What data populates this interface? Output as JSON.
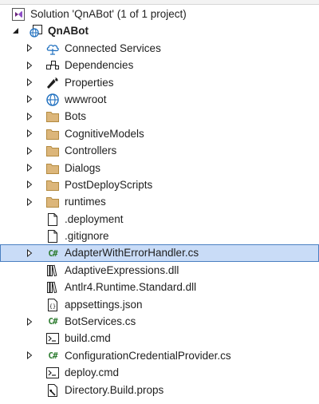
{
  "solution": {
    "label": "Solution 'QnABot' (1 of 1 project)"
  },
  "project": {
    "label": "QnABot"
  },
  "items": [
    {
      "label": "Connected Services",
      "icon": "connected-services-icon"
    },
    {
      "label": "Dependencies",
      "icon": "dependencies-icon"
    },
    {
      "label": "Properties",
      "icon": "properties-wrench-icon"
    },
    {
      "label": "wwwroot",
      "icon": "globe-icon"
    },
    {
      "label": "Bots",
      "icon": "folder-icon"
    },
    {
      "label": "CognitiveModels",
      "icon": "folder-icon"
    },
    {
      "label": "Controllers",
      "icon": "folder-icon"
    },
    {
      "label": "Dialogs",
      "icon": "folder-icon"
    },
    {
      "label": "PostDeployScripts",
      "icon": "folder-icon"
    },
    {
      "label": "runtimes",
      "icon": "folder-icon"
    },
    {
      "label": ".deployment",
      "icon": "file-icon"
    },
    {
      "label": ".gitignore",
      "icon": "file-icon"
    },
    {
      "label": "AdapterWithErrorHandler.cs",
      "icon": "csharp-file-icon",
      "selected": true
    },
    {
      "label": "AdaptiveExpressions.dll",
      "icon": "dll-icon"
    },
    {
      "label": "Antlr4.Runtime.Standard.dll",
      "icon": "dll-icon"
    },
    {
      "label": "appsettings.json",
      "icon": "json-icon"
    },
    {
      "label": "BotServices.cs",
      "icon": "csharp-file-icon"
    },
    {
      "label": "build.cmd",
      "icon": "cmd-script-icon"
    },
    {
      "label": "ConfigurationCredentialProvider.cs",
      "icon": "csharp-file-icon"
    },
    {
      "label": "deploy.cmd",
      "icon": "cmd-script-icon"
    },
    {
      "label": "Directory.Build.props",
      "icon": "props-file-icon"
    }
  ],
  "colors": {
    "selection_bg": "#c9dcf7",
    "selection_border": "#4a7fc1",
    "folder": "#dcb67a",
    "csharp": "#2f7d32",
    "globe": "#1e6fbf"
  }
}
